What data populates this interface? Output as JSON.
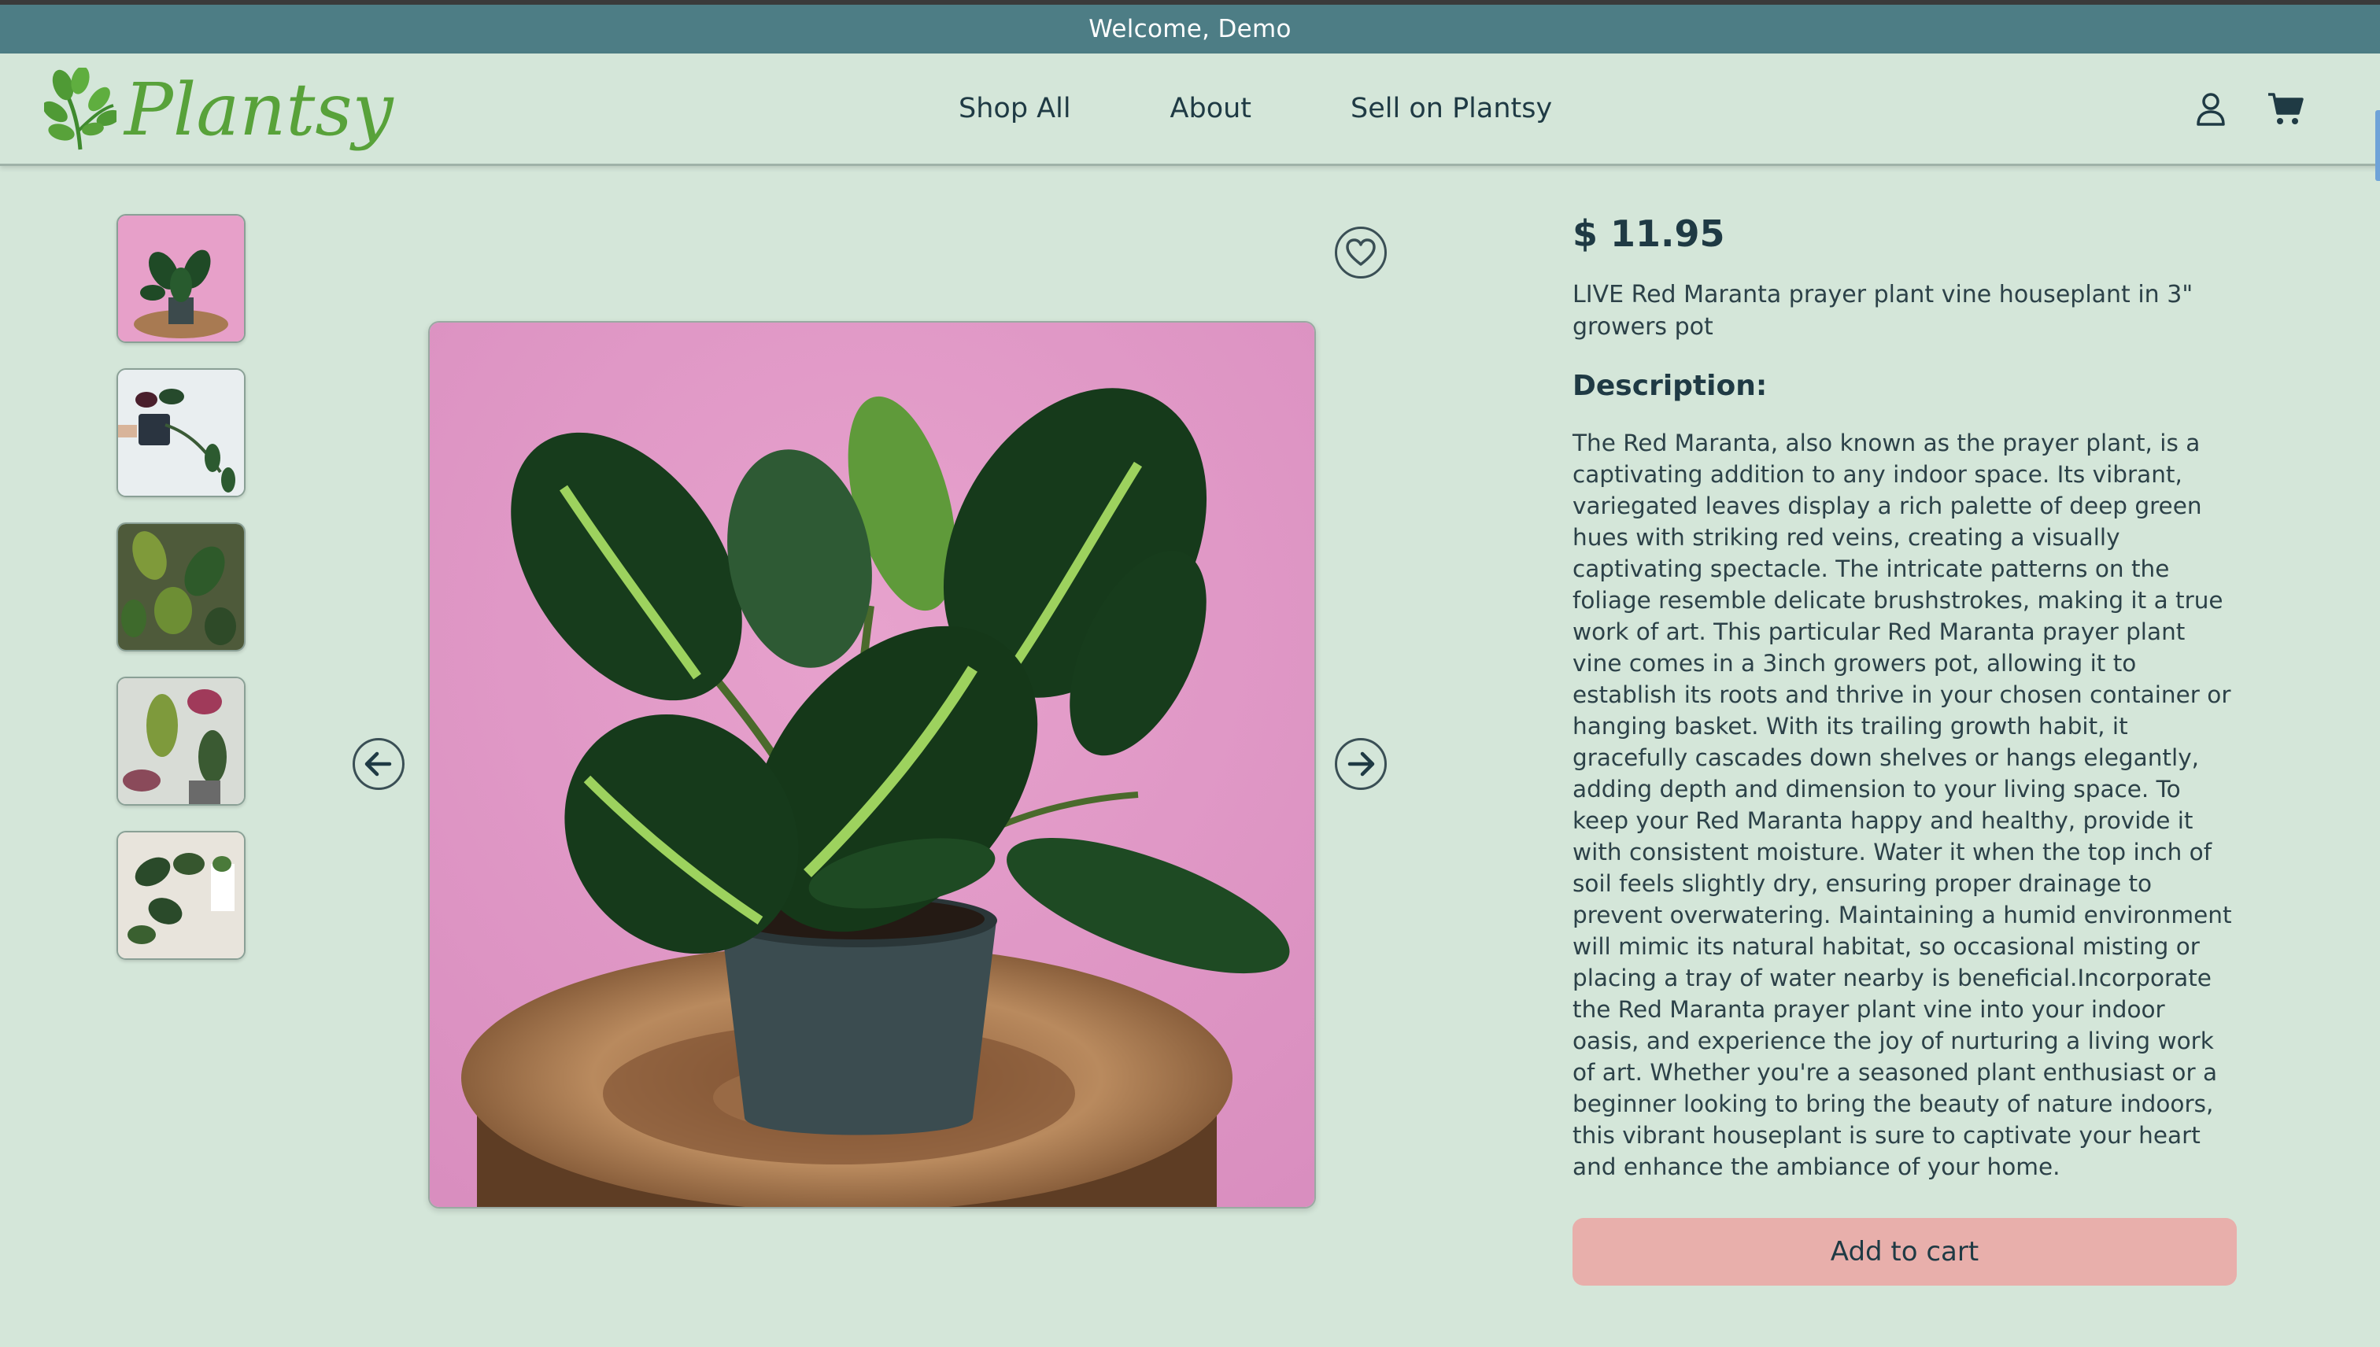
{
  "banner": {
    "welcome_text": "Welcome, Demo"
  },
  "header": {
    "logo_text": "Plantsy",
    "nav": [
      "Shop All",
      "About",
      "Sell on Plantsy"
    ],
    "icons": [
      "user-icon",
      "cart-icon"
    ]
  },
  "gallery": {
    "thumbnail_count": 5,
    "selected_index": 0,
    "main_image": "red-maranta-prayer-plant-photo",
    "controls": [
      "favorite-heart-icon",
      "previous-arrow-icon",
      "next-arrow-icon"
    ]
  },
  "product": {
    "price": "$ 11.95",
    "title": "LIVE Red Maranta prayer plant vine houseplant in 3\" growers pot",
    "description_heading": "Description:",
    "description": "The Red Maranta, also known as the prayer plant, is a captivating addition to any indoor space. Its vibrant, variegated leaves display a rich palette of deep green hues with striking red veins, creating a visually captivating spectacle. The intricate patterns on the foliage resemble delicate brushstrokes, making it a true work of art. This particular Red Maranta prayer plant vine comes in a 3inch growers pot, allowing it to establish its roots and thrive in your chosen container or hanging basket. With its trailing growth habit, it gracefully cascades down shelves or hangs elegantly, adding depth and dimension to your living space. To keep your Red Maranta happy and healthy, provide it with consistent moisture. Water it when the top inch of soil feels slightly dry, ensuring proper drainage to prevent overwatering. Maintaining a humid environment will mimic its natural habitat, so occasional misting or placing a tray of water nearby is beneficial.Incorporate the Red Maranta prayer plant vine into your indoor oasis, and experience the joy of nurturing a living work of art. Whether you're a seasoned plant enthusiast or a beginner looking to bring the beauty of nature indoors, this vibrant houseplant is sure to captivate your heart and enhance the ambiance of your home.",
    "add_to_cart_label": "Add to cart"
  },
  "colors": {
    "page_bg": "#d4e6d9",
    "banner_bg": "#4d7d85",
    "logo_green": "#58a23a",
    "text_dark": "#1f3a44",
    "add_to_cart_bg": "#e8afab"
  }
}
